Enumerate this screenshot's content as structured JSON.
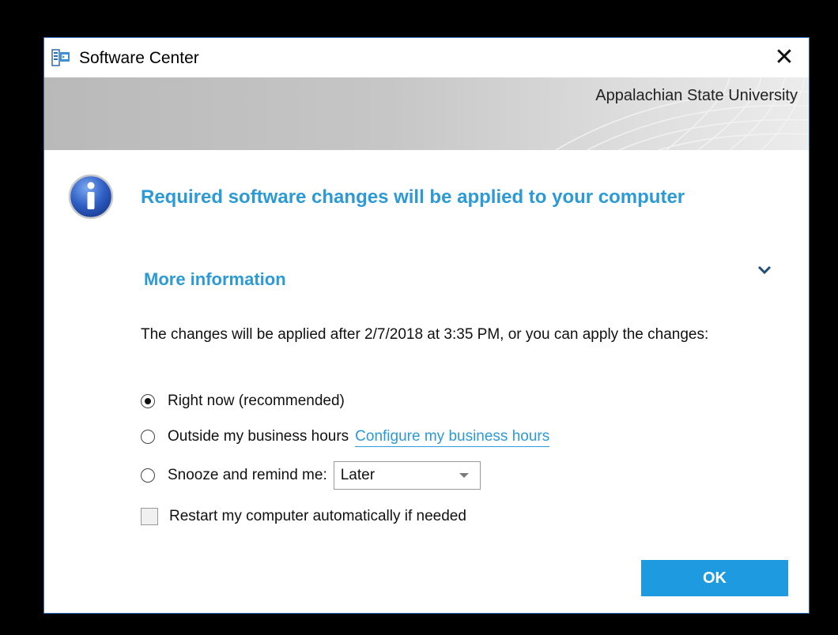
{
  "window": {
    "title": "Software Center",
    "close_symbol": "✕"
  },
  "banner": {
    "organization": "Appalachian State University"
  },
  "notification": {
    "icon": "info-icon",
    "heading": "Required software changes will be applied to your computer",
    "more_info_label": "More information",
    "chevron_icon": "chevron-down-icon",
    "description": "The changes will be applied after 2/7/2018 at 3:35 PM, or you can apply the changes:"
  },
  "options": {
    "right_now": "Right now (recommended)",
    "business_hours": "Outside my business hours",
    "configure_link": "Configure my business hours",
    "snooze": "Snooze and remind me:",
    "snooze_selected": "Later",
    "restart_label": "Restart my computer automatically if needed",
    "selected_option": "right_now",
    "restart_checked": false
  },
  "actions": {
    "ok_label": "OK"
  },
  "colors": {
    "accent": "#2b9ad6",
    "button": "#1e9be0",
    "border": "#2d6fbf"
  }
}
